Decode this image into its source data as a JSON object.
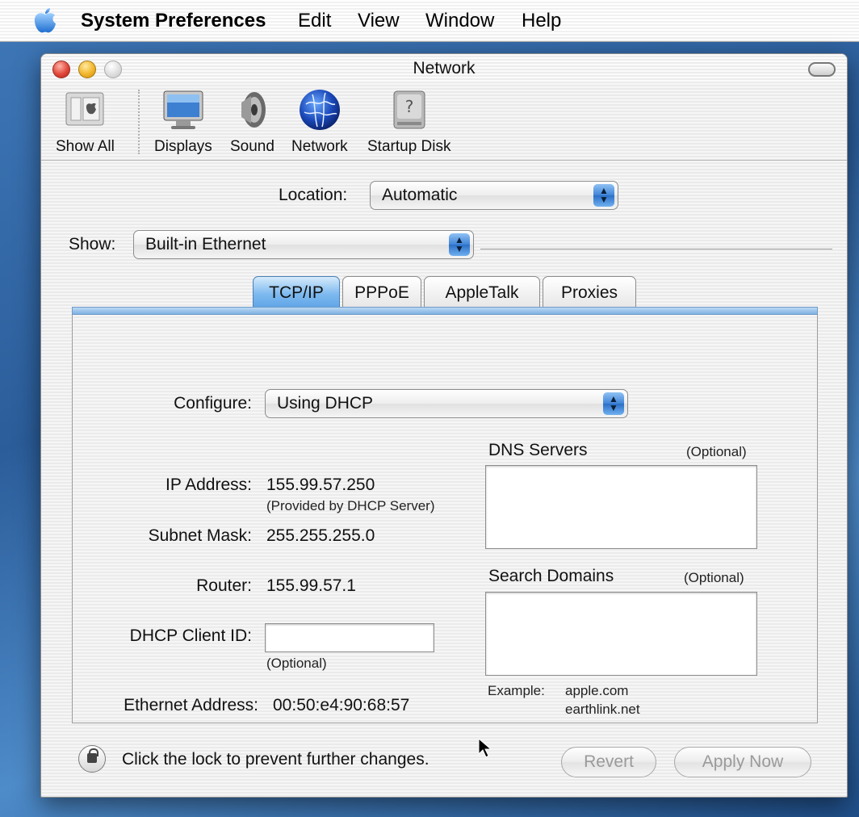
{
  "menubar": {
    "app_name": "System Preferences",
    "items": [
      "Edit",
      "View",
      "Window",
      "Help"
    ]
  },
  "window": {
    "title": "Network"
  },
  "toolbar": {
    "show_all": "Show All",
    "items": [
      "Displays",
      "Sound",
      "Network",
      "Startup Disk"
    ]
  },
  "location": {
    "label": "Location:",
    "value": "Automatic"
  },
  "show": {
    "label": "Show:",
    "value": "Built-in Ethernet"
  },
  "tabs": [
    "TCP/IP",
    "PPPoE",
    "AppleTalk",
    "Proxies"
  ],
  "active_tab": "TCP/IP",
  "tcpip": {
    "configure_label": "Configure:",
    "configure_value": "Using DHCP",
    "ip_label": "IP Address:",
    "ip_value": "155.99.57.250",
    "ip_note": "(Provided by DHCP Server)",
    "subnet_label": "Subnet Mask:",
    "subnet_value": "255.255.255.0",
    "router_label": "Router:",
    "router_value": "155.99.57.1",
    "client_id_label": "DHCP Client ID:",
    "client_id_value": "",
    "client_id_note": "(Optional)",
    "ethernet_label": "Ethernet Address:",
    "ethernet_value": "00:50:e4:90:68:57",
    "dns_label": "DNS Servers",
    "dns_optional": "(Optional)",
    "search_label": "Search Domains",
    "search_optional": "(Optional)",
    "example_label": "Example:",
    "example_1": "apple.com",
    "example_2": "earthlink.net"
  },
  "bottom": {
    "lock_text": "Click the lock to prevent further changes.",
    "revert": "Revert",
    "apply": "Apply Now"
  }
}
